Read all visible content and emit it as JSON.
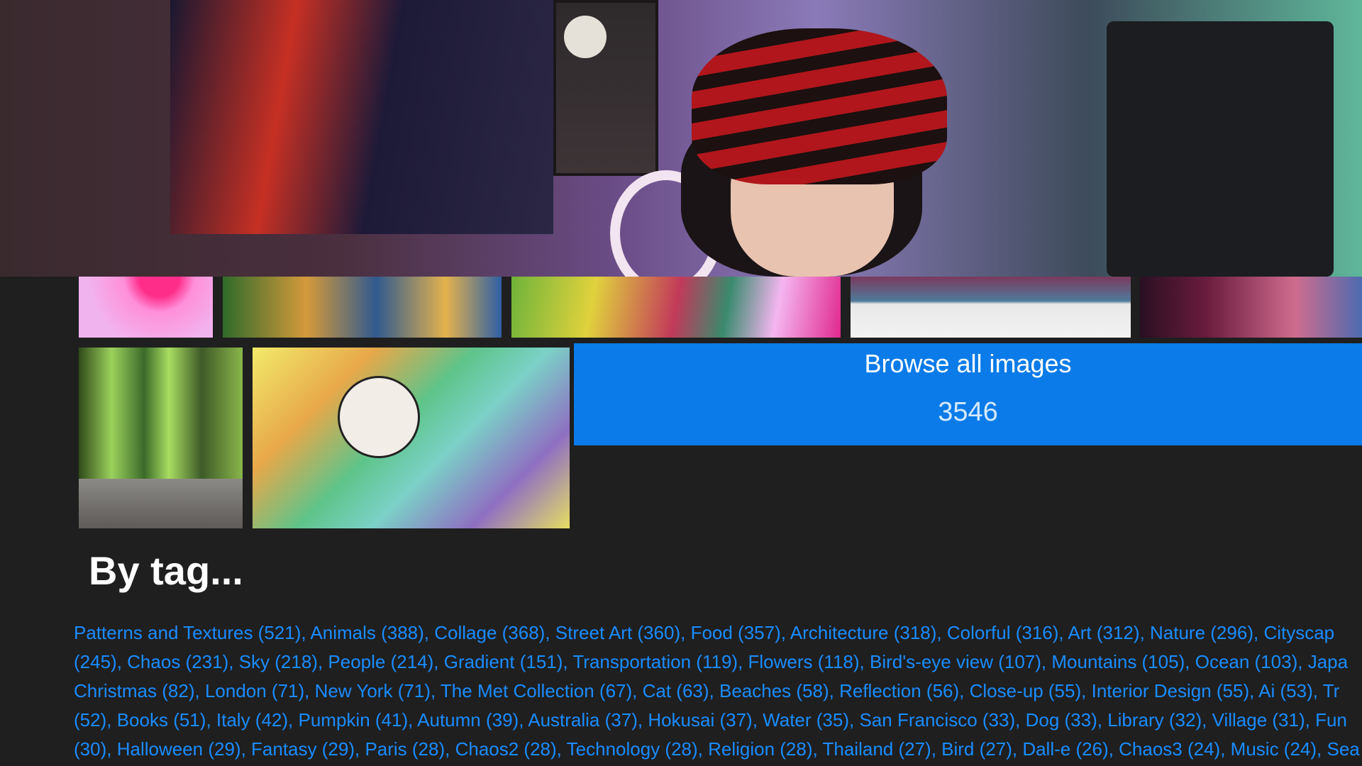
{
  "browse": {
    "title": "Browse all images",
    "count": "3546"
  },
  "section": {
    "heading": "By tag..."
  },
  "tag_lines": [
    [
      "Patterns and Textures (521)",
      "Animals (388)",
      "Collage (368)",
      "Street Art (360)",
      "Food (357)",
      "Architecture (318)",
      "Colorful (316)",
      "Art (312)",
      "Nature (296)",
      "Cityscap"
    ],
    [
      "(245)",
      "Chaos (231)",
      "Sky (218)",
      "People (214)",
      "Gradient (151)",
      "Transportation (119)",
      "Flowers (118)",
      "Bird's-eye view (107)",
      "Mountains (105)",
      "Ocean (103)",
      "Japa"
    ],
    [
      "Christmas (82)",
      "London (71)",
      "New York (71)",
      "The Met Collection (67)",
      "Cat (63)",
      "Beaches (58)",
      "Reflection (56)",
      "Close-up (55)",
      "Interior Design (55)",
      "Ai (53)",
      "Tr"
    ],
    [
      "(52)",
      "Books (51)",
      "Italy (42)",
      "Pumpkin (41)",
      "Autumn (39)",
      "Australia (37)",
      "Hokusai (37)",
      "Water (35)",
      "San Francisco (33)",
      "Dog (33)",
      "Library (32)",
      "Village (31)",
      "Fun"
    ],
    [
      "(30)",
      "Halloween (29)",
      "Fantasy (29)",
      "Paris (28)",
      "Chaos2 (28)",
      "Technology (28)",
      "Religion (28)",
      "Thailand (27)",
      "Bird (27)",
      "Dall-e (26)",
      "Chaos3 (24)",
      "Music (24)",
      "Sea"
    ]
  ]
}
